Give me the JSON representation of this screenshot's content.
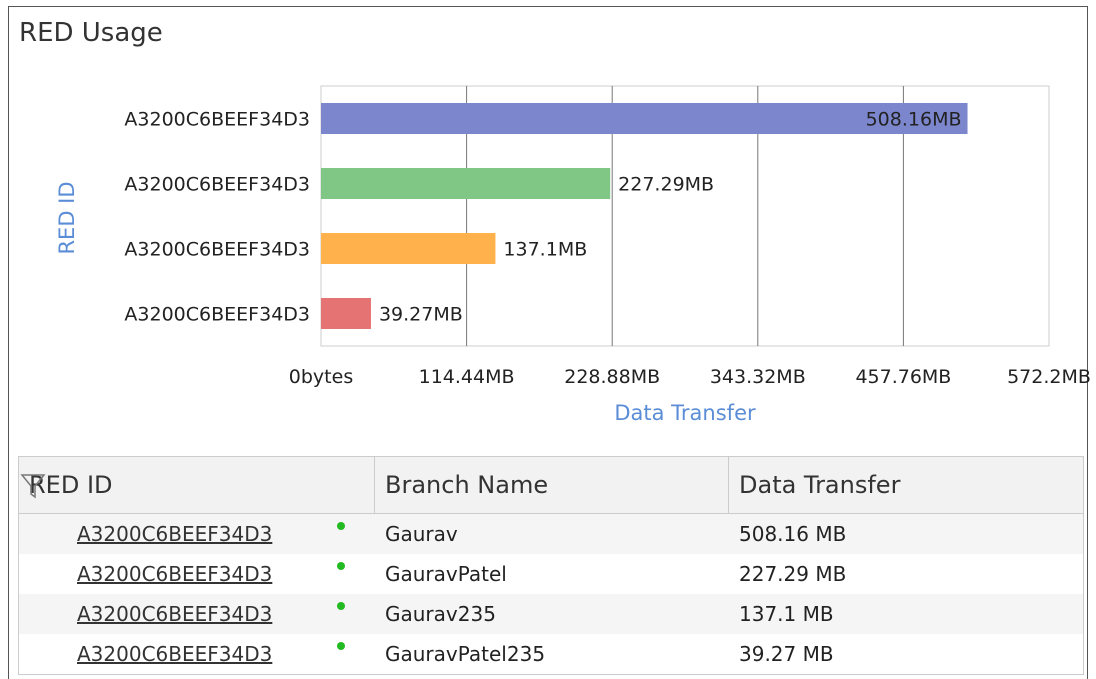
{
  "panel": {
    "title": "RED Usage"
  },
  "colors": {
    "axis_label": "#5b8dd6",
    "status_online": "#22b922"
  },
  "chart_data": {
    "type": "bar",
    "orientation": "horizontal",
    "categories": [
      "A3200C6BEEF34D3",
      "A3200C6BEEF34D3",
      "A3200C6BEEF34D3",
      "A3200C6BEEF34D3"
    ],
    "values_mb": [
      508.16,
      227.29,
      137.1,
      39.27
    ],
    "value_labels": [
      "508.16MB",
      "227.29MB",
      "137.1MB",
      "39.27MB"
    ],
    "bar_colors": [
      "#7b86cc",
      "#80c684",
      "#ffb14b",
      "#e57373"
    ],
    "xlabel": "Data Transfer",
    "ylabel": "RED ID",
    "xlim": [
      0,
      572.2
    ],
    "xticks": [
      0,
      114.44,
      228.88,
      343.32,
      457.76,
      572.2
    ],
    "xtick_labels": [
      "0bytes",
      "114.44MB",
      "228.88MB",
      "343.32MB",
      "457.76MB",
      "572.2MB"
    ],
    "grid": "vertical"
  },
  "table": {
    "columns": [
      "RED ID",
      "Branch Name",
      "Data Transfer"
    ],
    "rows": [
      {
        "red_id": "A3200C6BEEF34D3",
        "branch": "Gaurav",
        "transfer": "508.16 MB"
      },
      {
        "red_id": "A3200C6BEEF34D3",
        "branch": "GauravPatel",
        "transfer": "227.29 MB"
      },
      {
        "red_id": "A3200C6BEEF34D3",
        "branch": "Gaurav235",
        "transfer": "137.1 MB"
      },
      {
        "red_id": "A3200C6BEEF34D3",
        "branch": "GauravPatel235",
        "transfer": "39.27 MB"
      }
    ]
  }
}
